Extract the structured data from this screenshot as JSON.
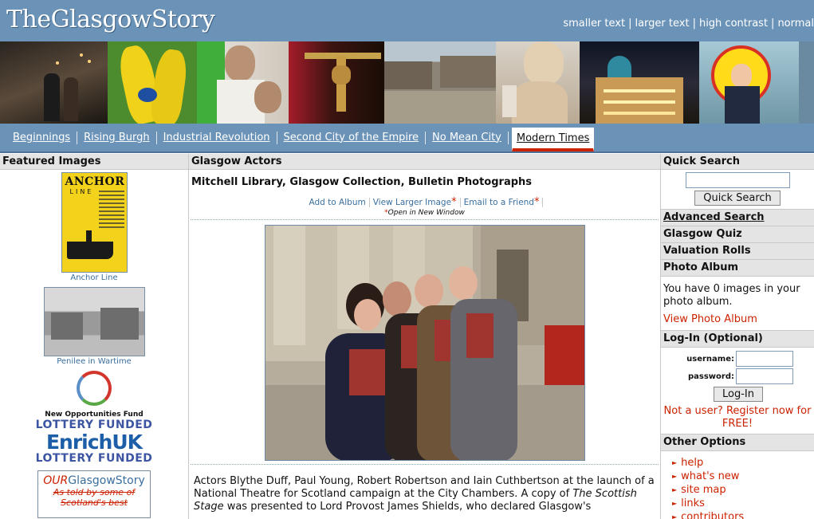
{
  "site": {
    "logo": "TheGlasgowStory",
    "accessibility": [
      "smaller text",
      "larger text",
      "high contrast",
      "normal"
    ]
  },
  "nav": {
    "items": [
      "Beginnings",
      "Rising Burgh",
      "Industrial Revolution",
      "Second City of the Empire",
      "No Mean City",
      "Modern Times"
    ],
    "active": "Modern Times"
  },
  "left": {
    "heading": "Featured Images",
    "featured": [
      {
        "caption": "Anchor Line",
        "poster_title": "ANCHOR",
        "poster_sub": "LINE"
      },
      {
        "caption": "Penilee in Wartime"
      }
    ],
    "lottery": {
      "fund": "New Opportunities Fund",
      "funded1": "LOTTERY FUNDED",
      "enrich": "EnrichUK",
      "funded2": "LOTTERY FUNDED"
    },
    "ogs": {
      "title_a": "OUR",
      "title_b": "GlasgowStory",
      "tagline": "As told by some of Scotland's best"
    }
  },
  "main": {
    "heading": "Glasgow Actors",
    "source": "Mitchell Library, Glasgow Collection, Bulletin Photographs",
    "actions": [
      "Add to Album",
      "View Larger Image",
      "Email to a Friend"
    ],
    "star": "*",
    "new_window_note": "Open in New Window",
    "description_pre": "Actors Blythe Duff, Paul Young, Robert Robertson and Iain Cuthbertson at the launch of a National Theatre for Scotland campaign at the City Chambers. A copy of ",
    "description_italic": "The Scottish Stage",
    "description_post": " was presented to Lord Provost James Shields, who declared Glasgow's"
  },
  "right": {
    "quick_search": {
      "heading": "Quick Search",
      "input_value": "",
      "button": "Quick Search"
    },
    "links": [
      "Advanced Search",
      "Glasgow Quiz",
      "Valuation Rolls"
    ],
    "album": {
      "heading": "Photo Album",
      "text": "You have 0 images in your photo album.",
      "link": "View Photo Album"
    },
    "login": {
      "heading": "Log-In (Optional)",
      "username_label": "username:",
      "password_label": "password:",
      "username_value": "",
      "password_value": "",
      "button": "Log-In",
      "register": "Not a user? Register now for FREE!"
    },
    "other": {
      "heading": "Other Options",
      "items": [
        "help",
        "what's new",
        "site map",
        "links",
        "contributors"
      ]
    }
  },
  "colors": {
    "header_blue": "#6b93b7",
    "link_red": "#cc2200",
    "link_blue": "#3a6f9e"
  }
}
